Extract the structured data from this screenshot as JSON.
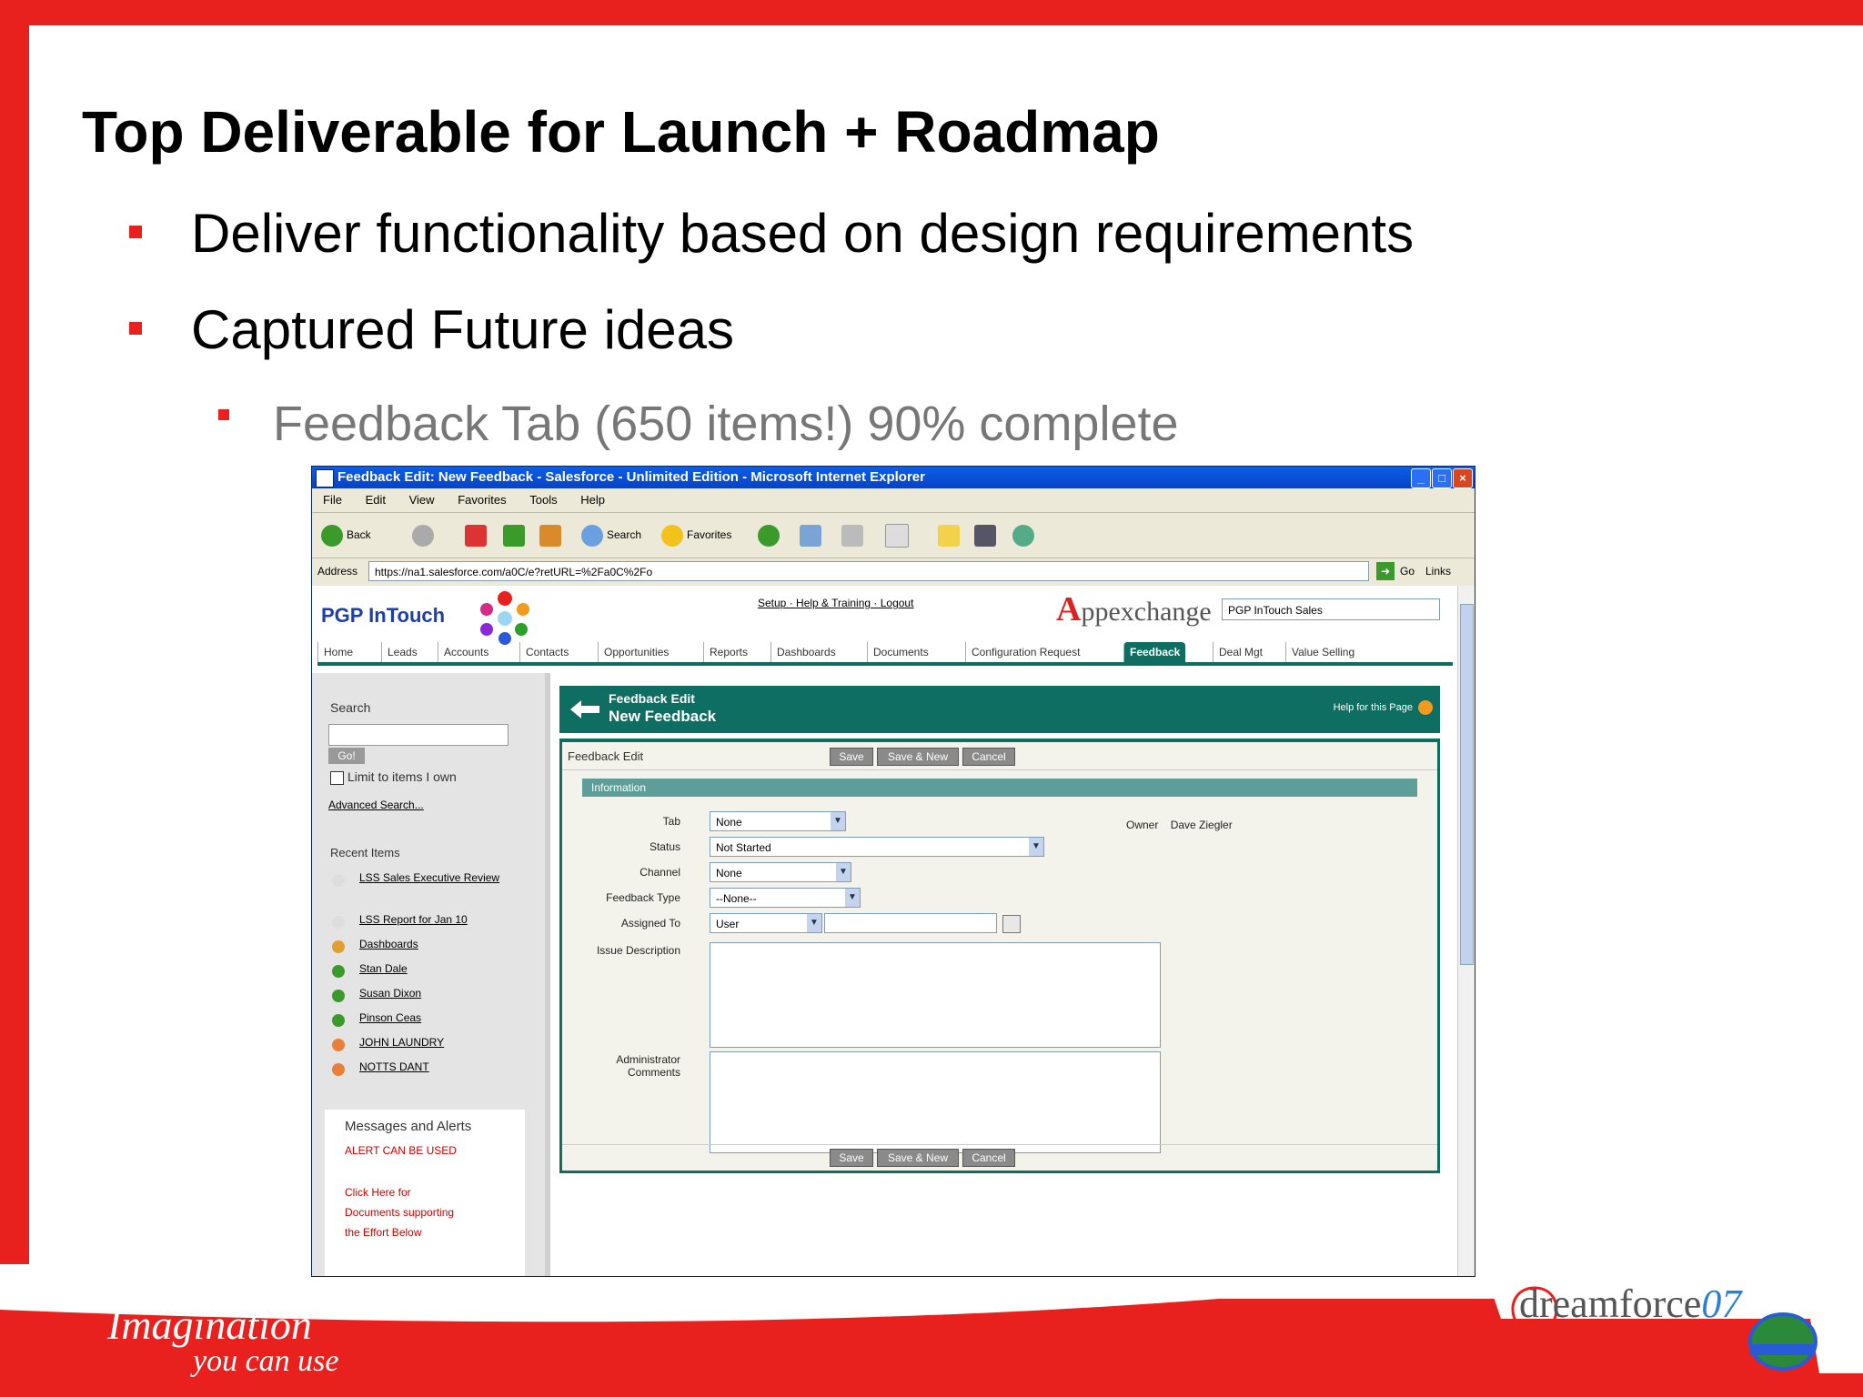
{
  "slide": {
    "title": "Top Deliverable for Launch + Roadmap",
    "bullets": [
      "Deliver functionality based on design requirements",
      "Captured Future ideas"
    ],
    "sub_bullet": "Feedback Tab (650 items!) 90% complete",
    "accent_color": "#e8201e"
  },
  "browser": {
    "title": "Feedback Edit: New Feedback - Salesforce - Unlimited Edition - Microsoft Internet Explorer",
    "menu": [
      "File",
      "Edit",
      "View",
      "Favorites",
      "Tools",
      "Help"
    ],
    "toolbar": {
      "back": "Back",
      "search": "Search",
      "favorites": "Favorites"
    },
    "address_label": "Address",
    "address_value": "https://na1.salesforce.com/a0C/e?retURL=%2Fa0C%2Fo",
    "go_label": "Go",
    "links_label": "Links"
  },
  "app": {
    "logo": "PGP InTouch",
    "top_links": "Setup · Help & Training · Logout",
    "appexchange_a": "A",
    "appexchange_rest": "ppexchange",
    "app_select": "PGP InTouch Sales",
    "tabs": [
      "Home",
      "Leads",
      "Accounts",
      "Contacts",
      "Opportunities",
      "Reports",
      "Dashboards",
      "Documents",
      "Configuration Request",
      "Feedback",
      "Deal Mgt",
      "Value Selling"
    ],
    "active_tab": "Feedback"
  },
  "sidebar": {
    "search_label": "Search",
    "go_label": "Go!",
    "limit_label": "Limit to items I own",
    "advanced_search": "Advanced Search...",
    "recent_label": "Recent Items",
    "recent_items": [
      "LSS Sales Executive Review",
      "LSS Report for Jan 10",
      "Dashboards",
      "Stan Dale",
      "Susan Dixon",
      "Pinson Ceas",
      "JOHN LAUNDRY",
      "NOTTS DANT"
    ],
    "messages_title": "Messages and Alerts",
    "messages_line1": "ALERT CAN BE USED",
    "messages_line2": "Click Here for",
    "messages_line3": "Documents supporting",
    "messages_line4": "the Effort Below"
  },
  "form": {
    "header_line1": "Feedback Edit",
    "header_line2": "New Feedback",
    "help_link": "Help for this Page",
    "bar_title": "Feedback Edit",
    "buttons": {
      "save": "Save",
      "save_new": "Save & New",
      "cancel": "Cancel"
    },
    "section": "Information",
    "labels": {
      "tab": "Tab",
      "status": "Status",
      "channel": "Channel",
      "feedback_type": "Feedback Type",
      "assigned_to": "Assigned To",
      "issue_description": "Issue Description",
      "admin_comments": "Administrator Comments",
      "owner": "Owner"
    },
    "values": {
      "tab": "None",
      "status": "Not Started",
      "channel": "None",
      "feedback_type": "--None--",
      "assigned_to": "User",
      "owner": "Dave Ziegler"
    }
  },
  "footer": {
    "tagline_1": "Imagination",
    "tagline_2": "you can use",
    "brand_a": "dream",
    "brand_b": "force",
    "brand_c": "07"
  }
}
